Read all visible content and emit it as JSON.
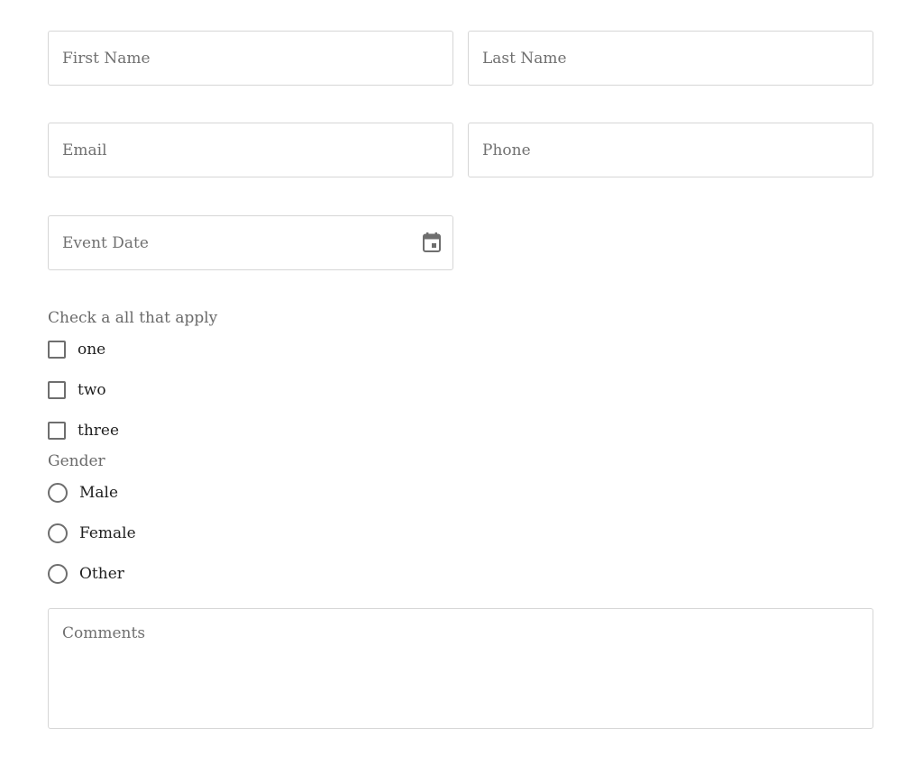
{
  "form": {
    "first_name": {
      "placeholder": "First Name",
      "value": ""
    },
    "last_name": {
      "placeholder": "Last Name",
      "value": ""
    },
    "email": {
      "placeholder": "Email",
      "value": ""
    },
    "phone": {
      "placeholder": "Phone",
      "value": ""
    },
    "event_date": {
      "placeholder": "Event Date",
      "value": "",
      "icon": "calendar-icon"
    },
    "checkbox_group": {
      "label": "Check a all that apply",
      "options": [
        {
          "label": "one",
          "checked": false
        },
        {
          "label": "two",
          "checked": false
        },
        {
          "label": "three",
          "checked": false
        }
      ]
    },
    "gender_group": {
      "label": "Gender",
      "options": [
        {
          "label": "Male",
          "selected": false
        },
        {
          "label": "Female",
          "selected": false
        },
        {
          "label": "Other",
          "selected": false
        }
      ]
    },
    "comments": {
      "placeholder": "Comments",
      "value": ""
    }
  },
  "colors": {
    "border": "#d6d6d6",
    "placeholder": "#707070",
    "control": "#6e6e6e",
    "label": "#6a6a6a"
  }
}
